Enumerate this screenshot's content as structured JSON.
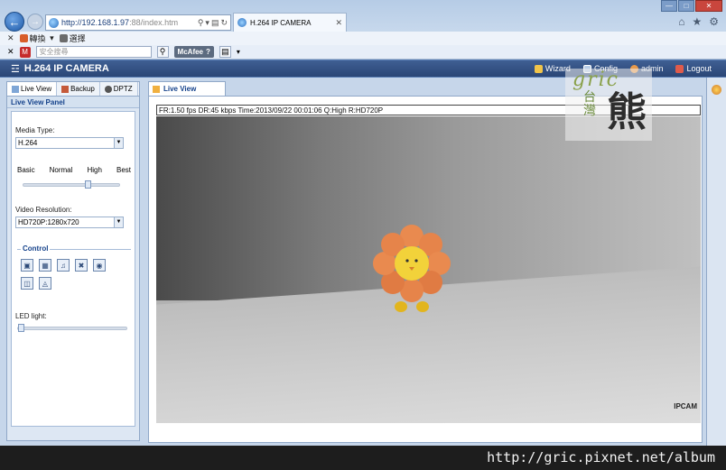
{
  "browser": {
    "url": "http://192.168.1.97:88/index.htm",
    "url_host": "http://192.168.1.97",
    "url_rest": ":88/index.htm",
    "tab_title": "H.264 IP CAMERA",
    "cmd_translate": "轉換",
    "cmd_select": "選擇",
    "search_placeholder": "安全搜尋",
    "mcafee_label": "McAfee"
  },
  "app": {
    "title": "H.264 IP CAMERA",
    "links": [
      {
        "label": "Wizard",
        "icon": "wizard-icon"
      },
      {
        "label": "Config",
        "icon": "config-icon"
      },
      {
        "label": "admin",
        "icon": "user-icon"
      },
      {
        "label": "Logout",
        "icon": "logout-icon"
      }
    ]
  },
  "left_tabs": [
    {
      "label": "Live View",
      "icon": "liveview-icon"
    },
    {
      "label": "Backup",
      "icon": "backup-icon"
    },
    {
      "label": "DPTZ",
      "icon": "dptz-icon"
    }
  ],
  "panel": {
    "title": "Live View Panel",
    "media_type_label": "Media Type:",
    "media_type_value": "H.264",
    "quality_labels": [
      "Basic",
      "Normal",
      "High",
      "Best"
    ],
    "quality_level": 0.75,
    "resolution_label": "Video Resolution:",
    "resolution_value": "HD720P:1280x720",
    "control_label": "Control",
    "led_label": "LED light:",
    "led_level": 0
  },
  "view": {
    "tab_label": "Live View",
    "osd_text": "FR:1.50 fps  DR:45 kbps Time:2013/09/22 00:01:06 Q:High R:HD720P",
    "camera_tag": "IPCAM"
  },
  "watermark": {
    "url": "http://gric.pixnet.net/album",
    "logo_text": "gric",
    "logo_tw": "台灣",
    "logo_bear": "熊"
  }
}
